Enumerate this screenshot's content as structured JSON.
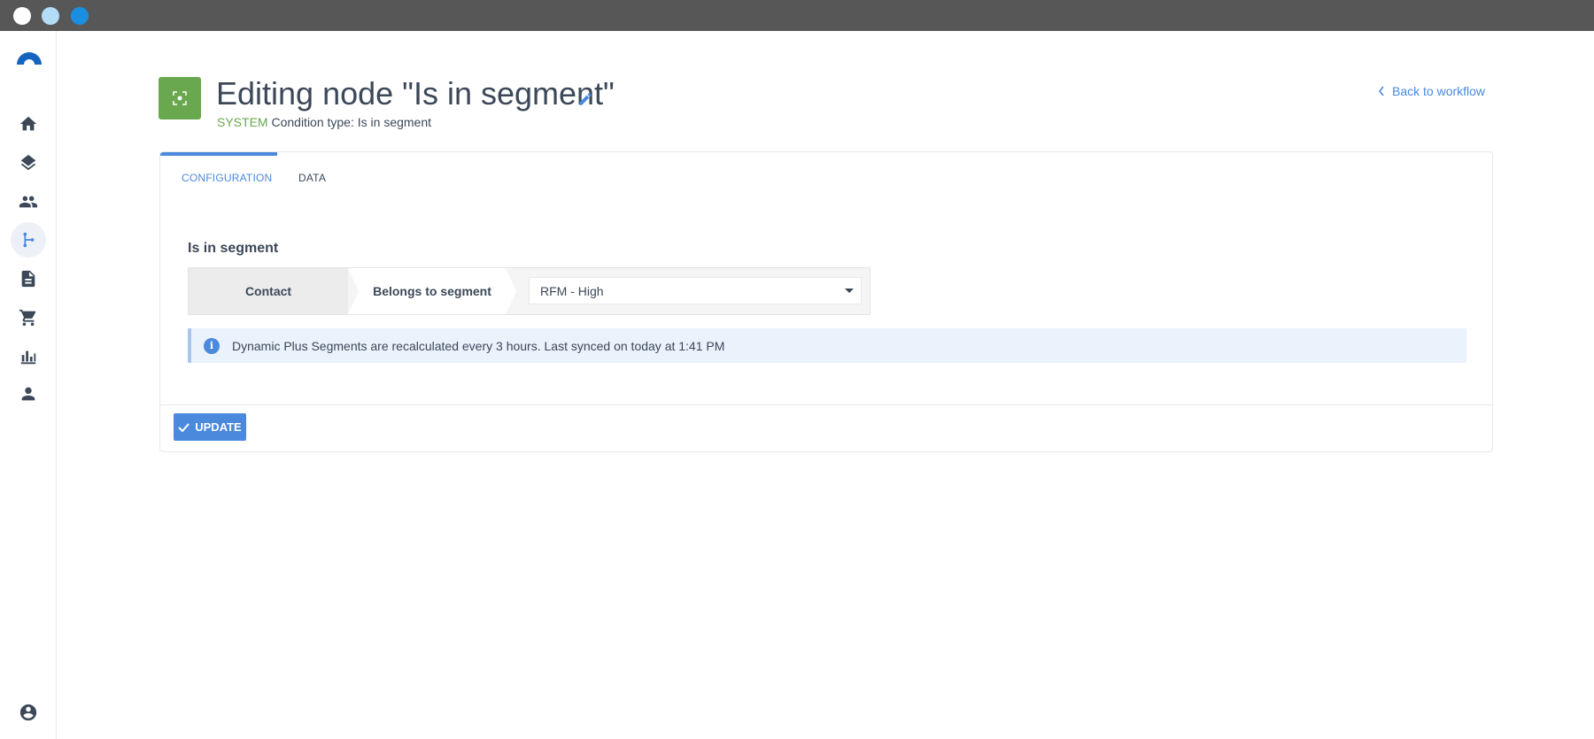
{
  "window": {
    "controls": [
      "close",
      "minimize",
      "maximize"
    ]
  },
  "sidebar": {
    "items": [
      {
        "name": "home",
        "icon": "home-icon"
      },
      {
        "name": "layers",
        "icon": "layers-icon"
      },
      {
        "name": "contacts",
        "icon": "people-icon"
      },
      {
        "name": "workflows",
        "icon": "workflow-icon",
        "active": true
      },
      {
        "name": "documents",
        "icon": "document-icon"
      },
      {
        "name": "commerce",
        "icon": "cart-icon"
      },
      {
        "name": "reports",
        "icon": "bar-chart-icon"
      },
      {
        "name": "users",
        "icon": "person-icon"
      }
    ],
    "bottom": {
      "name": "account",
      "icon": "account-circle-icon"
    }
  },
  "header": {
    "title": "Editing node \"Is in segment\"",
    "system_label": "SYSTEM",
    "condition_type": "Condition type: Is in segment",
    "back_link": "Back to workflow"
  },
  "tabs": [
    {
      "label": "CONFIGURATION",
      "active": true
    },
    {
      "label": "DATA",
      "active": false
    }
  ],
  "condition": {
    "section_title": "Is in segment",
    "crumb_1": "Contact",
    "crumb_2": "Belongs to segment",
    "selected_segment": "RFM - High"
  },
  "info": {
    "message": "Dynamic Plus Segments are recalculated every 3 hours. Last synced on today at 1:41 PM"
  },
  "footer": {
    "update_label": "UPDATE"
  },
  "colors": {
    "accent": "#4a89dc",
    "node_green": "#6aa84f",
    "titlebar": "#575757"
  }
}
